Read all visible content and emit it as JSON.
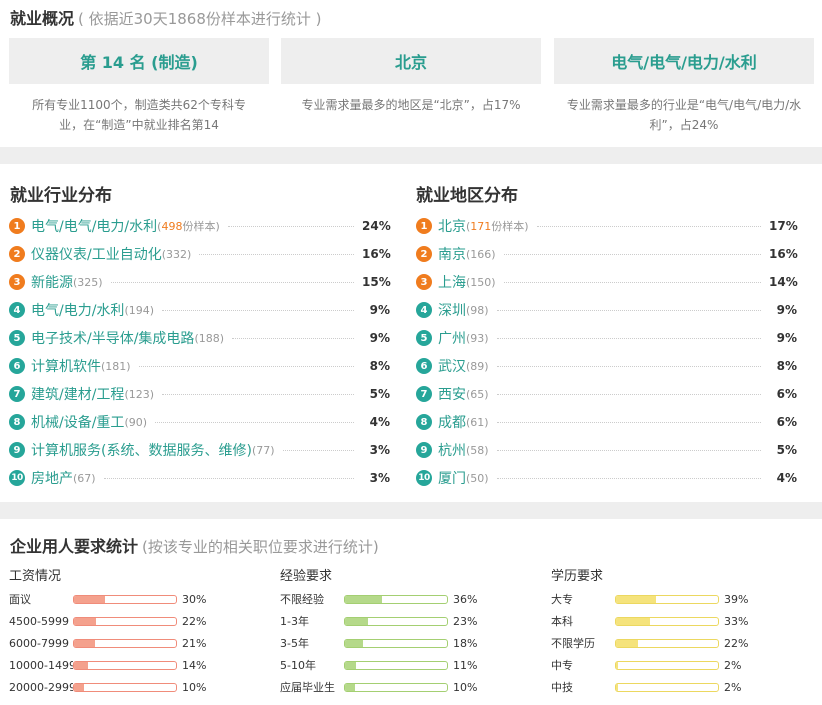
{
  "overview": {
    "title": "就业概况",
    "subtitle": "( 依据近30天1868份样本进行统计 )",
    "cards": [
      {
        "value": "第 14 名 (制造)",
        "desc": "所有专业1100个，制造类共62个专科专业，在“制造”中就业排名第14"
      },
      {
        "value": "北京",
        "desc": "专业需求量最多的地区是“北京”，占17%"
      },
      {
        "value": "电气/电气/电力/水利",
        "desc": "专业需求量最多的行业是“电气/电气/电力/水利”，占24%"
      }
    ]
  },
  "industry": {
    "title": "就业行业分布",
    "items": [
      {
        "rank": "1",
        "name": "电气/电气/电力/水利",
        "count": "498",
        "suffix": "份样本",
        "pct": "24%"
      },
      {
        "rank": "2",
        "name": "仪器仪表/工业自动化",
        "count": "332",
        "pct": "16%"
      },
      {
        "rank": "3",
        "name": "新能源",
        "count": "325",
        "pct": "15%"
      },
      {
        "rank": "4",
        "name": "电气/电力/水利",
        "count": "194",
        "pct": "9%"
      },
      {
        "rank": "5",
        "name": "电子技术/半导体/集成电路",
        "count": "188",
        "pct": "9%"
      },
      {
        "rank": "6",
        "name": "计算机软件",
        "count": "181",
        "pct": "8%"
      },
      {
        "rank": "7",
        "name": "建筑/建材/工程",
        "count": "123",
        "pct": "5%"
      },
      {
        "rank": "8",
        "name": "机械/设备/重工",
        "count": "90",
        "pct": "4%"
      },
      {
        "rank": "9",
        "name": "计算机服务(系统、数据服务、维修)",
        "count": "77",
        "pct": "3%"
      },
      {
        "rank": "10",
        "name": "房地产",
        "count": "67",
        "pct": "3%"
      }
    ]
  },
  "region": {
    "title": "就业地区分布",
    "items": [
      {
        "rank": "1",
        "name": "北京",
        "count": "171",
        "suffix": "份样本",
        "pct": "17%"
      },
      {
        "rank": "2",
        "name": "南京",
        "count": "166",
        "pct": "16%"
      },
      {
        "rank": "3",
        "name": "上海",
        "count": "150",
        "pct": "14%"
      },
      {
        "rank": "4",
        "name": "深圳",
        "count": "98",
        "pct": "9%"
      },
      {
        "rank": "5",
        "name": "广州",
        "count": "93",
        "pct": "9%"
      },
      {
        "rank": "6",
        "name": "武汉",
        "count": "89",
        "pct": "8%"
      },
      {
        "rank": "7",
        "name": "西安",
        "count": "65",
        "pct": "6%"
      },
      {
        "rank": "8",
        "name": "成都",
        "count": "61",
        "pct": "6%"
      },
      {
        "rank": "9",
        "name": "杭州",
        "count": "58",
        "pct": "5%"
      },
      {
        "rank": "10",
        "name": "厦门",
        "count": "50",
        "pct": "4%"
      }
    ]
  },
  "requirements": {
    "title": "企业用人要求统计",
    "subtitle": "(按该专业的相关职位要求进行统计)",
    "columns": [
      {
        "title": "工资情况",
        "color": "#f4a18d",
        "border": "#f08c7a",
        "rows": [
          {
            "label": "面议",
            "pct": "30%",
            "value": 30
          },
          {
            "label": "4500-5999",
            "pct": "22%",
            "value": 22
          },
          {
            "label": "6000-7999",
            "pct": "21%",
            "value": 21
          },
          {
            "label": "10000-14999",
            "pct": "14%",
            "value": 14
          },
          {
            "label": "20000-29999",
            "pct": "10%",
            "value": 10
          }
        ]
      },
      {
        "title": "经验要求",
        "color": "#b5d98a",
        "border": "#a4cf72",
        "rows": [
          {
            "label": "不限经验",
            "pct": "36%",
            "value": 36
          },
          {
            "label": "1-3年",
            "pct": "23%",
            "value": 23
          },
          {
            "label": "3-5年",
            "pct": "18%",
            "value": 18
          },
          {
            "label": "5-10年",
            "pct": "11%",
            "value": 11
          },
          {
            "label": "应届毕业生",
            "pct": "10%",
            "value": 10
          }
        ]
      },
      {
        "title": "学历要求",
        "color": "#f5e37c",
        "border": "#ecd860",
        "rows": [
          {
            "label": "大专",
            "pct": "39%",
            "value": 39
          },
          {
            "label": "本科",
            "pct": "33%",
            "value": 33
          },
          {
            "label": "不限学历",
            "pct": "22%",
            "value": 22
          },
          {
            "label": "中专",
            "pct": "2%",
            "value": 2
          },
          {
            "label": "中技",
            "pct": "2%",
            "value": 2
          }
        ]
      }
    ]
  }
}
